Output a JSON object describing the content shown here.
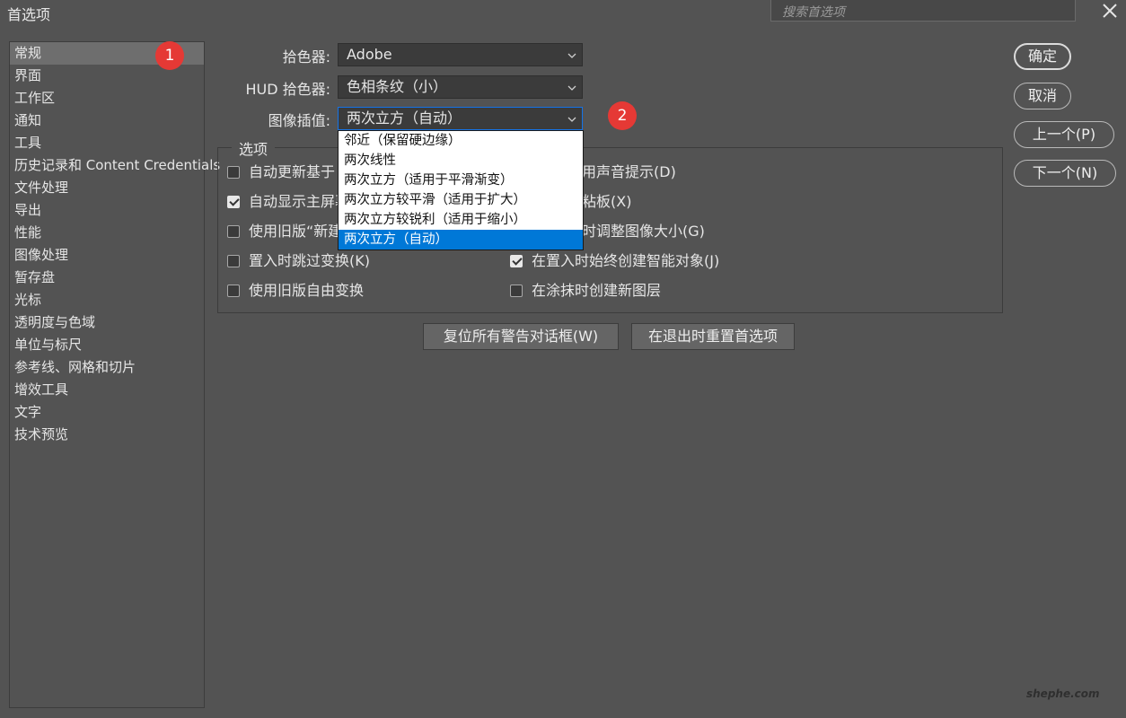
{
  "window": {
    "title": "首选项",
    "search_placeholder": "搜索首选项"
  },
  "sidebar": {
    "items": [
      {
        "label": "常规"
      },
      {
        "label": "界面"
      },
      {
        "label": "工作区"
      },
      {
        "label": "通知"
      },
      {
        "label": "工具"
      },
      {
        "label": "历史记录和 Content Credentials"
      },
      {
        "label": "文件处理"
      },
      {
        "label": "导出"
      },
      {
        "label": "性能"
      },
      {
        "label": "图像处理"
      },
      {
        "label": "暂存盘"
      },
      {
        "label": "光标"
      },
      {
        "label": "透明度与色域"
      },
      {
        "label": "单位与标尺"
      },
      {
        "label": "参考线、网格和切片"
      },
      {
        "label": "增效工具"
      },
      {
        "label": "文字"
      },
      {
        "label": "技术预览"
      }
    ]
  },
  "badges": {
    "one": "1",
    "two": "2"
  },
  "fields": {
    "color_picker": {
      "label": "拾色器:",
      "value": "Adobe"
    },
    "hud_picker": {
      "label": "HUD 拾色器:",
      "value": "色相条纹（小）"
    },
    "interpolation": {
      "label": "图像插值:",
      "value": "两次立方（自动）"
    }
  },
  "dropdown": {
    "options": [
      {
        "label": "邻近（保留硬边缘）"
      },
      {
        "label": "两次线性"
      },
      {
        "label": "两次立方（适用于平滑渐变）"
      },
      {
        "label": "两次立方较平滑（适用于扩大）"
      },
      {
        "label": "两次立方较锐利（适用于缩小）"
      },
      {
        "label": "两次立方（自动）"
      }
    ],
    "selected": "两次立方（自动）"
  },
  "options": {
    "title": "选项",
    "left": [
      {
        "label": "自动更新基于",
        "checked": false
      },
      {
        "label": "自动显示主屏幕",
        "checked": true
      },
      {
        "label": "使用旧版“新建",
        "checked": false
      },
      {
        "label": "置入时跳过变换(K)",
        "checked": false
      },
      {
        "label": "使用旧版自由变换",
        "checked": false
      }
    ],
    "right": [
      {
        "label": "用声音提示(D)"
      },
      {
        "label": "粘板(X)"
      },
      {
        "label": "时调整图像大小(G)"
      },
      {
        "label": "在置入时始终创建智能对象(J)",
        "checked": true
      },
      {
        "label": "在涂抹时创建新图层",
        "checked": false
      }
    ]
  },
  "buttons": {
    "reset_warnings": "复位所有警告对话框(W)",
    "reset_on_quit": "在退出时重置首选项",
    "ok": "确定",
    "cancel": "取消",
    "prev": "上一个(P)",
    "next": "下一个(N)"
  },
  "watermark": "shephe.com"
}
